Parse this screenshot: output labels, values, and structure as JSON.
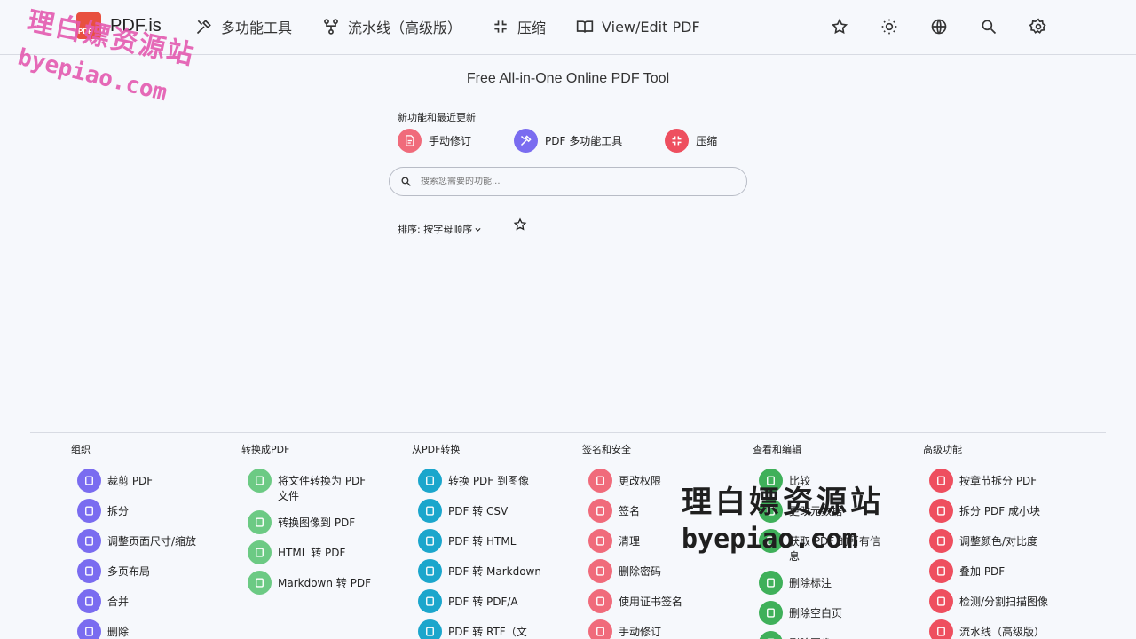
{
  "brand": {
    "name": "PDF.is"
  },
  "nav": [
    {
      "label": "多功能工具",
      "icon": "tools-icon"
    },
    {
      "label": "流水线（高级版）",
      "icon": "pipeline-icon"
    },
    {
      "label": "压缩",
      "icon": "compress-icon"
    },
    {
      "label": "View/Edit PDF",
      "icon": "book-open-icon"
    }
  ],
  "watermark": {
    "cn": "理白嫖资源站",
    "url": "byepiao.com"
  },
  "subtitle": "Free All-in-One Online PDF Tool",
  "recent": {
    "label": "新功能和最近更新",
    "items": [
      {
        "label": "手动修订",
        "color": "#f06b7b"
      },
      {
        "label": "PDF 多功能工具",
        "color": "#7a6cf0"
      },
      {
        "label": "压缩",
        "color": "#ee4f5f"
      }
    ]
  },
  "search": {
    "placeholder": "搜索您需要的功能..."
  },
  "sort": {
    "label": "排序: 按字母顺序"
  },
  "categories": [
    {
      "title": "组织",
      "color": "#7a6cf0",
      "tools": [
        "裁剪 PDF",
        "拆分",
        "调整页面尺寸/缩放",
        "多页布局",
        "合并",
        "删除"
      ]
    },
    {
      "title": "转换成PDF",
      "color": "#6cca84",
      "tools": [
        "将文件转换为 PDF 文件",
        "转换图像到 PDF",
        "HTML 转 PDF",
        "Markdown 转 PDF"
      ]
    },
    {
      "title": "从PDF转换",
      "color": "#1ba6cc",
      "tools": [
        "转换 PDF 到图像",
        "PDF 转 CSV",
        "PDF 转 HTML",
        "PDF 转 Markdown",
        "PDF 转 PDF/A",
        "PDF 转 RTF（文"
      ]
    },
    {
      "title": "签名和安全",
      "color": "#f06b7b",
      "tools": [
        "更改权限",
        "签名",
        "清理",
        "删除密码",
        "使用证书签名",
        "手动修订"
      ]
    },
    {
      "title": "查看和编辑",
      "color": "#3fb05a",
      "tools": [
        "比较",
        "更改元数据",
        "获取 PDF 的所有信息",
        "删除标注",
        "删除空白页",
        "删除图像"
      ]
    },
    {
      "title": "高级功能",
      "color": "#ee4f5f",
      "tools": [
        "按章节拆分 PDF",
        "拆分 PDF 成小块",
        "调整颜色/对比度",
        "叠加 PDF",
        "检测/分割扫描图像",
        "流水线（高级版）"
      ]
    }
  ]
}
